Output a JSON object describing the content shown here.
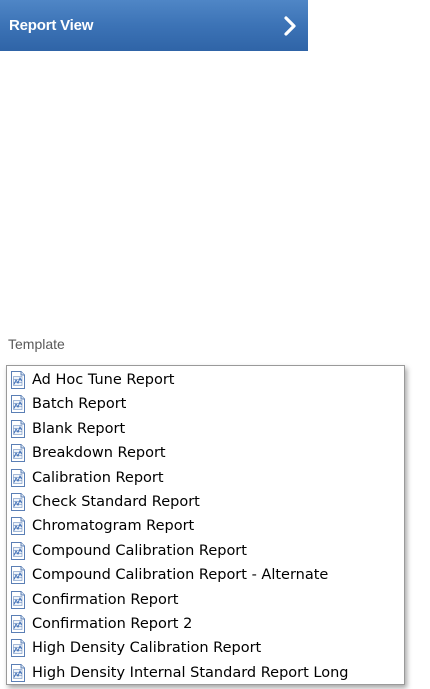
{
  "report_view": {
    "label": "Report View",
    "icon": "chevron-right-icon"
  },
  "template": {
    "header": "Template",
    "items": [
      {
        "label": "Ad Hoc Tune Report"
      },
      {
        "label": "Batch Report"
      },
      {
        "label": "Blank Report"
      },
      {
        "label": "Breakdown Report"
      },
      {
        "label": "Calibration Report"
      },
      {
        "label": "Check Standard Report"
      },
      {
        "label": "Chromatogram Report"
      },
      {
        "label": "Compound Calibration Report"
      },
      {
        "label": "Compound Calibration Report - Alternate"
      },
      {
        "label": "Confirmation Report"
      },
      {
        "label": "Confirmation Report 2"
      },
      {
        "label": "High Density Calibration Report"
      },
      {
        "label": "High Density Internal Standard Report Long"
      }
    ]
  },
  "colors": {
    "button_top": "#4f86c6",
    "button_bottom": "#2f64a7",
    "header_text": "#5a5a5a"
  }
}
